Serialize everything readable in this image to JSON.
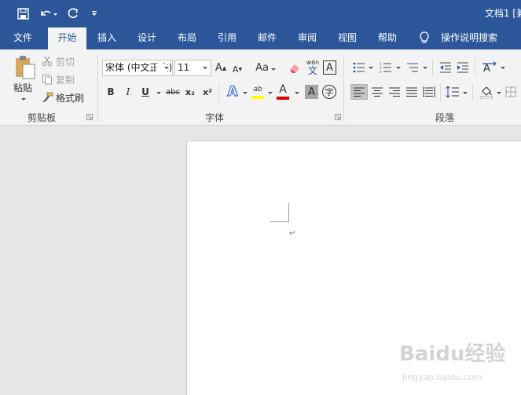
{
  "window": {
    "doc_title": "文档1 [兼"
  },
  "tabs": [
    {
      "label": "文件"
    },
    {
      "label": "开始"
    },
    {
      "label": "插入"
    },
    {
      "label": "设计"
    },
    {
      "label": "布局"
    },
    {
      "label": "引用"
    },
    {
      "label": "邮件"
    },
    {
      "label": "审阅"
    },
    {
      "label": "视图"
    },
    {
      "label": "帮助"
    },
    {
      "label": "操作说明搜索"
    }
  ],
  "clipboard": {
    "paste_label": "粘贴",
    "cut_label": "剪切",
    "copy_label": "复制",
    "format_painter_label": "格式刷",
    "group_label": "剪贴板"
  },
  "font": {
    "font_name": "宋体 (中文正文)",
    "font_size": "11",
    "change_case_label": "Aa",
    "phonetic_top": "wén",
    "phonetic_bottom": "文",
    "border_char": "A",
    "bold": "B",
    "italic": "I",
    "underline": "U",
    "strike": "abc",
    "subscript": "x₂",
    "superscript": "x²",
    "effects": "A",
    "highlight_text": "ab",
    "font_color": "A",
    "shading_char": "A",
    "enclose_char": "字",
    "group_label": "字体"
  },
  "paragraph": {
    "group_label": "段落"
  },
  "colors": {
    "ribbon_blue": "#2b579a",
    "highlight_yellow": "#ffff00",
    "font_color_red": "#e00000"
  },
  "watermark": {
    "brand": "Baidu经验",
    "url": "jingyan.baidu.com"
  }
}
